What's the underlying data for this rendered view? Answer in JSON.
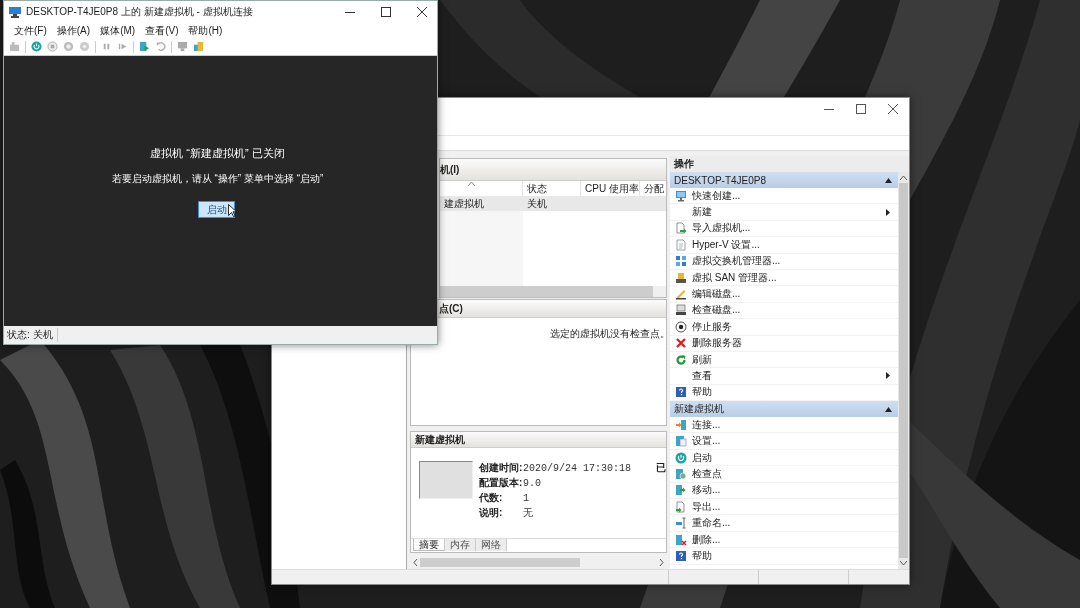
{
  "vm_window": {
    "title": "DESKTOP-T4JE0P8 上的 新建虚拟机 - 虚拟机连接",
    "menu": [
      "文件(F)",
      "操作(A)",
      "媒体(M)",
      "查看(V)",
      "帮助(H)"
    ],
    "message_title": "虚拟机 “新建虚拟机” 已关闭",
    "message": "若要启动虚拟机，请从 “操作” 菜单中选择 “启动”",
    "start_button": "启动",
    "status": "状态: 关机"
  },
  "manager": {
    "vm_list": {
      "title": "机(I)",
      "columns": [
        "",
        "状态",
        "CPU 使用率",
        "分配"
      ],
      "rows": [
        {
          "cells": [
            "建虚拟机",
            "关机"
          ],
          "selected": true
        }
      ]
    },
    "checkpoints": {
      "title": "点(C)",
      "message": "选定的虚拟机没有检查点。"
    },
    "details": {
      "title": "新建虚拟机",
      "fields": [
        {
          "label": "创建时间:",
          "value": "2020/9/24 17:30:18"
        },
        {
          "label": "配置版本:",
          "value": "9.0"
        },
        {
          "label": "代数:",
          "value": "1"
        },
        {
          "label": "说明:",
          "value": "无"
        }
      ],
      "cut_text": "已",
      "tabs": [
        {
          "label": "摘要",
          "selected": true
        },
        {
          "label": "内存",
          "selected": false
        },
        {
          "label": "网络",
          "selected": false
        }
      ]
    },
    "actions": {
      "title": "操作",
      "groups": [
        {
          "title": "DESKTOP-T4JE0P8",
          "expanded": true,
          "items": [
            {
              "label": "快速创建...",
              "submenu": false
            },
            {
              "label": "新建",
              "submenu": true
            },
            {
              "label": "导入虚拟机...",
              "submenu": false
            },
            {
              "label": "Hyper-V 设置...",
              "submenu": false
            },
            {
              "label": "虚拟交换机管理器...",
              "submenu": false
            },
            {
              "label": "虚拟 SAN 管理器...",
              "submenu": false
            },
            {
              "label": "编辑磁盘...",
              "submenu": false
            },
            {
              "label": "检查磁盘...",
              "submenu": false
            },
            {
              "label": "停止服务",
              "submenu": false
            },
            {
              "label": "删除服务器",
              "submenu": false
            },
            {
              "label": "刷新",
              "submenu": false
            },
            {
              "label": "查看",
              "submenu": true
            },
            {
              "label": "帮助",
              "submenu": false
            }
          ]
        },
        {
          "title": "新建虚拟机",
          "expanded": true,
          "items": [
            {
              "label": "连接...",
              "submenu": false
            },
            {
              "label": "设置...",
              "submenu": false
            },
            {
              "label": "启动",
              "submenu": false
            },
            {
              "label": "检查点",
              "submenu": false
            },
            {
              "label": "移动...",
              "submenu": false
            },
            {
              "label": "导出...",
              "submenu": false
            },
            {
              "label": "重命名...",
              "submenu": false
            },
            {
              "label": "删除...",
              "submenu": false
            },
            {
              "label": "帮助",
              "submenu": false
            }
          ]
        }
      ]
    }
  }
}
